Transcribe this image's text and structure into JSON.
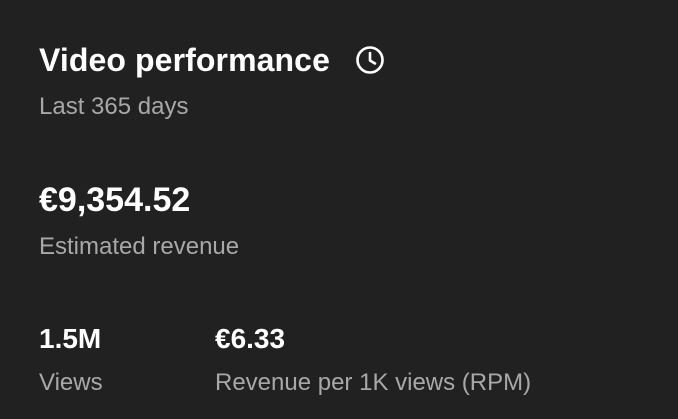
{
  "card": {
    "title": "Video performance",
    "icon": "clock-icon",
    "period": "Last 365 days"
  },
  "revenue": {
    "value": "€9,354.52",
    "label": "Estimated revenue"
  },
  "metrics": [
    {
      "value": "1.5M",
      "label": "Views"
    },
    {
      "value": "€6.33",
      "label": "Revenue per 1K views (RPM)"
    }
  ],
  "colors": {
    "background": "#212121",
    "primary_text": "#ffffff",
    "secondary_text": "#a8a8a8"
  }
}
